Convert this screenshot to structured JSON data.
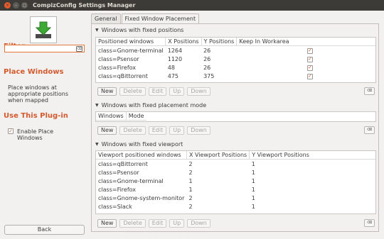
{
  "window": {
    "title": "CompizConfig Settings Manager",
    "close_glyph": "×",
    "min_glyph": "–",
    "max_glyph": "□"
  },
  "sidebar": {
    "filter_heading": "Filter",
    "filter_value": "",
    "clear_glyph": "⌫",
    "plugin_heading": "Place Windows",
    "plugin_description": "Place windows at appropriate positions when mapped",
    "use_heading": "Use This Plug-in",
    "enable_label": "Enable Place Windows",
    "enable_checked": true,
    "back_label": "Back"
  },
  "tabs": [
    {
      "label": "General",
      "active": false
    },
    {
      "label": "Fixed Window Placement",
      "active": true
    }
  ],
  "sections": {
    "fixed_positions": {
      "title": "Windows with fixed positions",
      "columns": [
        "Positioned windows",
        "X Positions",
        "Y Positions",
        "Keep In Workarea"
      ],
      "rows": [
        {
          "window": "class=Gnome-terminal",
          "x": "1264",
          "y": "26",
          "keep": true
        },
        {
          "window": "class=Psensor",
          "x": "1120",
          "y": "26",
          "keep": true
        },
        {
          "window": "class=Firefox",
          "x": "48",
          "y": "26",
          "keep": true
        },
        {
          "window": "class=qBittorrent",
          "x": "475",
          "y": "375",
          "keep": true
        }
      ]
    },
    "fixed_mode": {
      "title": "Windows with fixed placement mode",
      "columns": [
        "Windows",
        "Mode"
      ],
      "rows": []
    },
    "fixed_viewport": {
      "title": "Windows with fixed viewport",
      "columns": [
        "Viewport positioned windows",
        "X Viewport Positions",
        "Y Viewport Positions"
      ],
      "rows": [
        {
          "window": "class=qBittorrent",
          "x": "2",
          "y": "1"
        },
        {
          "window": "class=Psensor",
          "x": "2",
          "y": "1"
        },
        {
          "window": "class=Gnome-terminal",
          "x": "1",
          "y": "1"
        },
        {
          "window": "class=Firefox",
          "x": "1",
          "y": "1"
        },
        {
          "window": "class=Gnome-system-monitor",
          "x": "2",
          "y": "1"
        },
        {
          "window": "class=Slack",
          "x": "2",
          "y": "1"
        }
      ]
    }
  },
  "buttons": {
    "new": "New",
    "delete": "Delete",
    "edit": "Edit",
    "up": "Up",
    "down": "Down",
    "clear_glyph": "⌫"
  },
  "glyphs": {
    "expander": "▼",
    "check": "✓"
  },
  "colors": {
    "accent": "#d35a2e",
    "titlebar": "#3c3b37"
  }
}
